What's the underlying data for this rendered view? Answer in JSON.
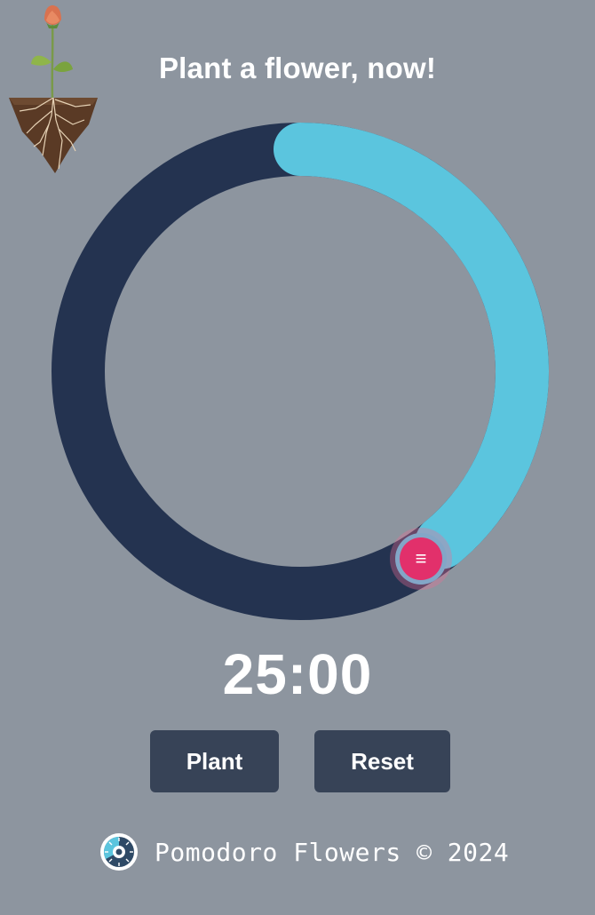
{
  "header": {
    "title": "Plant a flower, now!"
  },
  "timer": {
    "display": "25:00",
    "progress_fraction": 0.39
  },
  "colors": {
    "background": "#8d959f",
    "ring_track": "#243350",
    "ring_progress": "#5bc5de",
    "handle": "#e2306b",
    "button": "#374357"
  },
  "handle": {
    "icon": "menu-icon",
    "glyph": "≡"
  },
  "buttons": {
    "plant_label": "Plant",
    "reset_label": "Reset"
  },
  "footer": {
    "logo_icon": "pomodoro-flowers-logo",
    "text": "Pomodoro Flowers © 2024"
  },
  "illustration": {
    "icon": "sprouting-flower-with-roots"
  }
}
